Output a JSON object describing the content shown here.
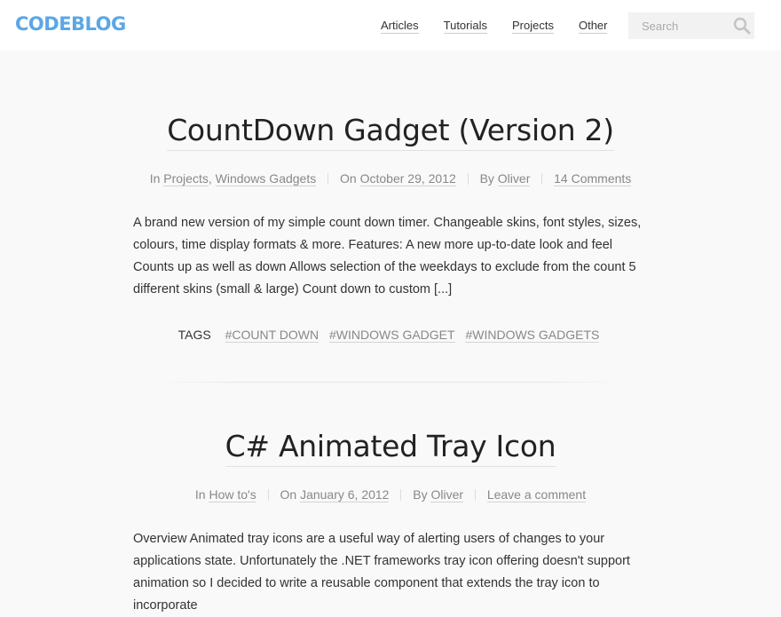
{
  "site": {
    "logo": "CODEBLOG",
    "brand_color": "#5aa7e6"
  },
  "nav": {
    "items": [
      {
        "label": "Articles"
      },
      {
        "label": "Tutorials"
      },
      {
        "label": "Projects"
      },
      {
        "label": "Other"
      }
    ]
  },
  "search": {
    "placeholder": "Search",
    "icon": "search-icon"
  },
  "posts": [
    {
      "title": "CountDown Gadget (Version 2)",
      "meta": {
        "in_prefix": "In",
        "categories": [
          "Projects",
          "Windows Gadgets"
        ],
        "date_prefix": "On",
        "date": "October 29, 2012",
        "author_prefix": "By",
        "author": "Oliver",
        "comments": "14 Comments"
      },
      "excerpt": "A brand new version of my simple count down timer. Changeable skins, font styles, sizes, colours, time display formats & more. Features: A new more up-to-date look and feel Counts up as well as down Allows selection of the weekdays to exclude from the count 5 different skins (small & large) Count down to custom [...]",
      "tags_label": "TAGS",
      "tags": [
        "#COUNT DOWN",
        "#WINDOWS GADGET",
        "#WINDOWS GADGETS"
      ]
    },
    {
      "title": "C# Animated Tray Icon",
      "meta": {
        "in_prefix": "In",
        "categories": [
          "How to's"
        ],
        "date_prefix": "On",
        "date": "January 6, 2012",
        "author_prefix": "By",
        "author": "Oliver",
        "comments": "Leave a comment"
      },
      "excerpt": "Overview Animated tray icons are a useful way of alerting users of changes to your applications state. Unfortunately the .NET frameworks tray icon offering doesn't support animation so I decided to write a reusable component that extends the tray icon to incorporate"
    }
  ]
}
